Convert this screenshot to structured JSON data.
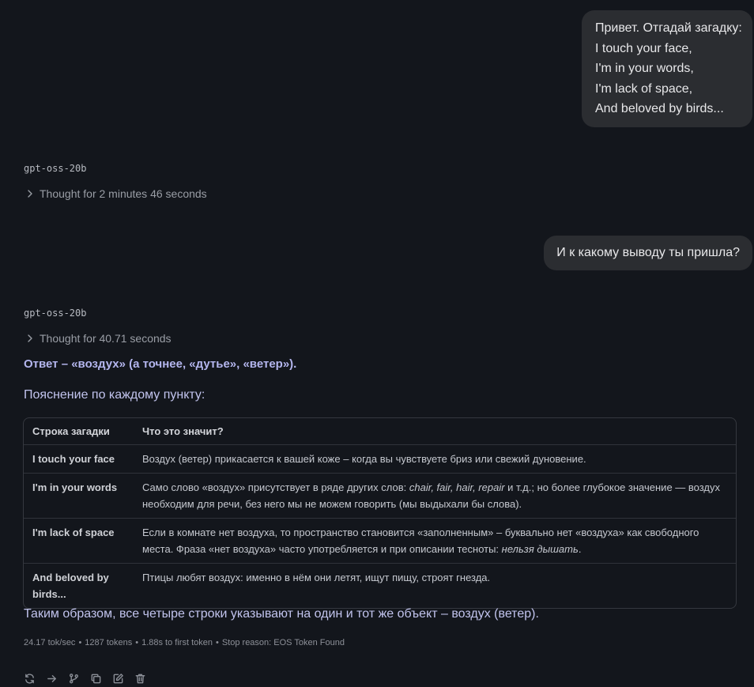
{
  "messages": {
    "user1_lines": [
      "Привет. Отгадай загадку:",
      "I touch your face,",
      "I'm in your words,",
      "I'm lack of space,",
      "And beloved by birds..."
    ],
    "model1": {
      "name": "gpt-oss-20b",
      "thought": "Thought for 2 minutes 46 seconds"
    },
    "user2": "И к какому выводу ты пришла?",
    "model2": {
      "name": "gpt-oss-20b",
      "thought": "Thought for 40.71 seconds",
      "answer": "Ответ – «воздух» (а точнее, «дутье», «ветер»).",
      "explain": "Пояснение по каждому пункту:",
      "table": {
        "headers": [
          "Строка загадки",
          "Что это значит?"
        ],
        "rows": [
          {
            "line": "I touch your face",
            "meaning": "Воздух (ветер) прикасается к вашей коже – когда вы чувствуете бриз или свежий дуновение."
          },
          {
            "line": "I'm in your words",
            "meaning_a": "Само слово «воздух» присутствует в ряде других слов: ",
            "meaning_em": "chair, fair, hair, repair",
            "meaning_b": " и т.д.; но более глубокое значение — воздух необходим для речи, без него мы не можем говорить (мы выдыхали бы слова)."
          },
          {
            "line": "I'm lack of space",
            "meaning_a": "Если в комнате нет воздуха, то пространство становится «заполненным» – буквально нет «воздуха» как свободного места. Фраза «нет воздуха» часто употребляется и при описании тесноты: ",
            "meaning_em": "нельзя дышать",
            "meaning_b": "."
          },
          {
            "line": "And beloved by birds...",
            "meaning": "Птицы любят воздух: именно в нём они летят, ищут пищу, строят гнезда."
          }
        ]
      },
      "summary": "Таким образом, все четыре строки указывают на один и тот же объект – воздух (ветер).",
      "stats": {
        "speed": "24.17 tok/sec",
        "tokens": "1287 tokens",
        "ttft": "1.88s to first token",
        "stop": "Stop reason: EOS Token Found",
        "sep": "•"
      }
    }
  },
  "icons": [
    "regenerate-icon",
    "continue-icon",
    "branch-icon",
    "copy-icon",
    "edit-icon",
    "delete-icon"
  ]
}
